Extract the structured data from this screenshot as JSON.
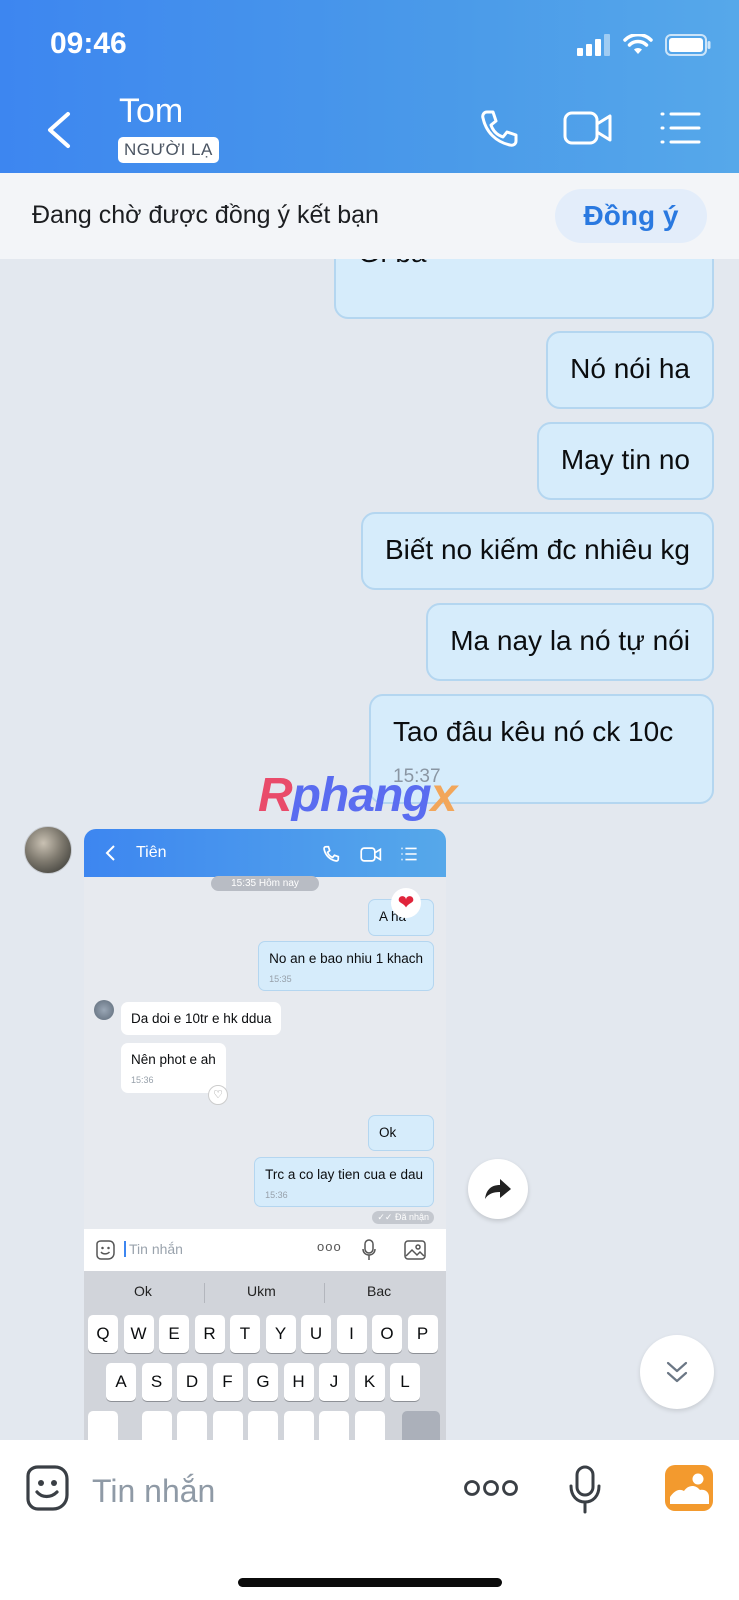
{
  "status_bar": {
    "time": "09:46"
  },
  "header": {
    "contact_name": "Tom",
    "badge": "NGƯỜI LẠ"
  },
  "friend_request": {
    "text": "Đang chờ được đồng ý kết bạn",
    "accept_label": "Đồng ý"
  },
  "messages": [
    {
      "text": "Gì ba"
    },
    {
      "text": "Nó nói ha"
    },
    {
      "text": "May tin no"
    },
    {
      "text": "Biết no kiếm đc nhiêu kg"
    },
    {
      "text": "Ma nay la nó tự nói"
    },
    {
      "text": "Tao đâu kêu nó ck 10c",
      "time": "15:37"
    }
  ],
  "watermark": {
    "part1": "R",
    "part2": "phang",
    "part3": "x"
  },
  "embedded_screenshot": {
    "header_title": "Tiên",
    "date_chip": "15:35 Hôm nay",
    "messages": [
      {
        "text": "A hả",
        "direction": "out"
      },
      {
        "text": "No an e bao nhiu 1 khach",
        "time": "15:35",
        "direction": "out"
      },
      {
        "text": "Da doi e 10tr e hk ddua",
        "direction": "in"
      },
      {
        "text": "Nên phot e ah",
        "time": "15:36",
        "direction": "in"
      },
      {
        "text": "Ok",
        "direction": "out"
      },
      {
        "text": "Trc a co lay tien cua e dau",
        "time": "15:36",
        "direction": "out"
      }
    ],
    "status": "Đã nhận",
    "input_placeholder": "Tin nhắn",
    "suggestions": [
      "Ok",
      "Ukm",
      "Bac"
    ],
    "keyboard_row1": [
      "Q",
      "W",
      "E",
      "R",
      "T",
      "Y",
      "U",
      "I",
      "O",
      "P"
    ],
    "keyboard_row2": [
      "A",
      "S",
      "D",
      "F",
      "G",
      "H",
      "J",
      "K",
      "L"
    ]
  },
  "input": {
    "placeholder": "Tin nhắn"
  },
  "icons": {
    "back": "chevron-left-icon",
    "call": "phone-icon",
    "video": "video-camera-icon",
    "menu": "list-menu-icon",
    "forward": "share-forward-icon",
    "scroll_down": "double-chevron-down-icon",
    "emoji": "sticker-smile-icon",
    "more": "more-dots-icon",
    "mic": "microphone-icon",
    "image": "image-gallery-icon"
  },
  "colors": {
    "header": "#3d86f0",
    "bubble_out": "#d6ecfb",
    "accept_text": "#2a79e0",
    "image_icon": "#f39a2e"
  }
}
